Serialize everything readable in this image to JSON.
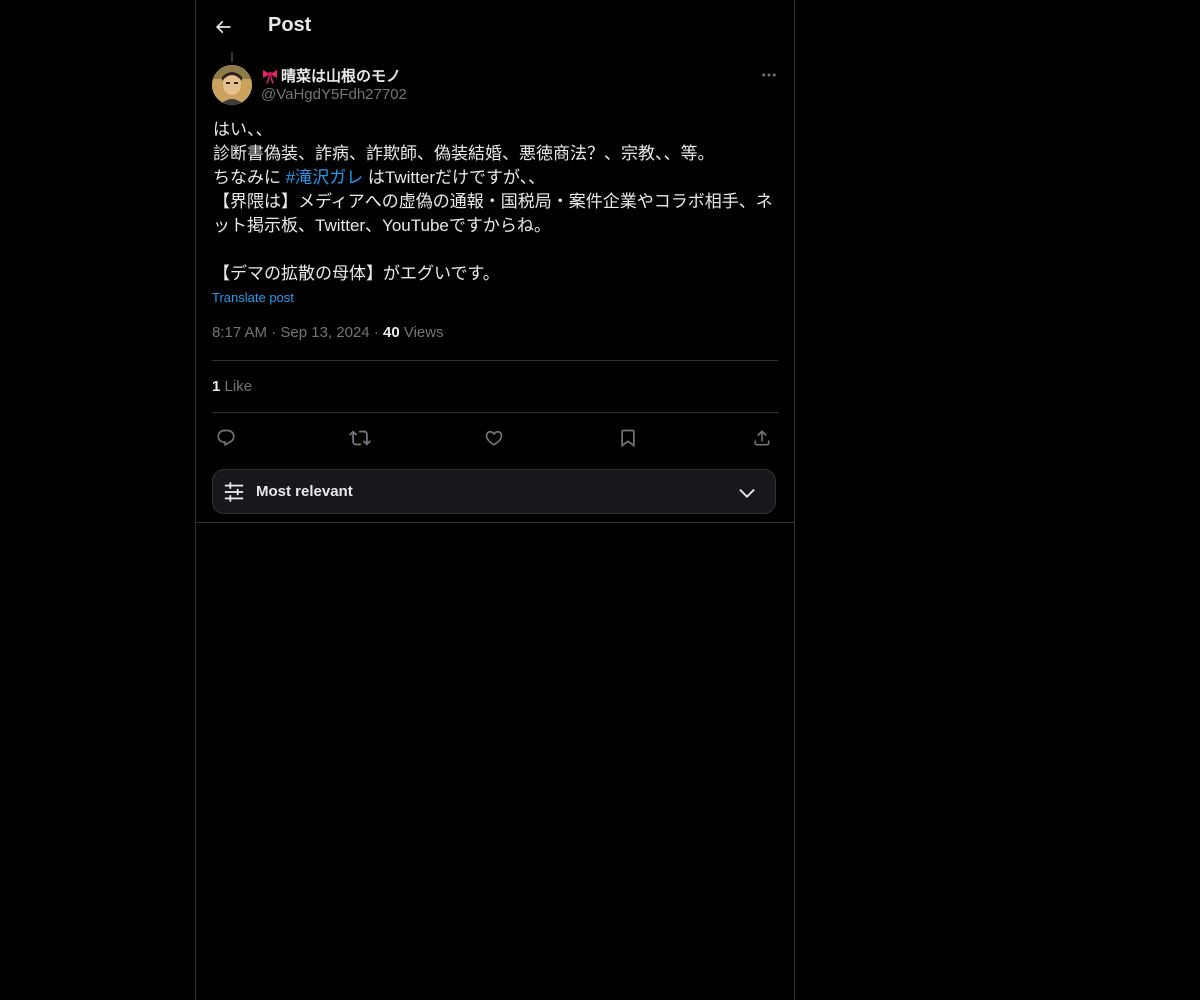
{
  "header": {
    "title": "Post"
  },
  "post": {
    "author_name": "晴菜は山根のモノ",
    "author_handle": "@VaHgdY5Fdh27702",
    "lines": {
      "l1": "はい、、",
      "l2": "診断書偽装、詐病、詐欺師、偽装結婚、悪徳商法？、宗教、、等。",
      "l3_prefix": "ちなみに ",
      "l3_hashtag": "#滝沢ガレ",
      "l3_suffix": " はTwitterだけですが、、",
      "l4": "【界隈は】メディアへの虚偽の通報・国税局・案件企業やコラボ相手、ネット掲示板、Twitter、YouTubeですからね。",
      "l6": "【デマの拡散の母体】がエグいです。"
    },
    "translate_label": "Translate post",
    "time": "8:17 AM",
    "date": "Sep 13, 2024",
    "separator": "·",
    "views_count": "40",
    "views_label": "Views",
    "likes_count": "1",
    "likes_label": "Like"
  },
  "actions": [
    "reply-icon",
    "repost-icon",
    "like-icon",
    "bookmark-icon",
    "share-icon"
  ],
  "sort": {
    "label": "Most relevant"
  },
  "colors": {
    "background": "#000000",
    "text": "#e7e9ea",
    "secondary": "#71767b",
    "accent": "#1d9bf0",
    "border": "#2f3336"
  }
}
